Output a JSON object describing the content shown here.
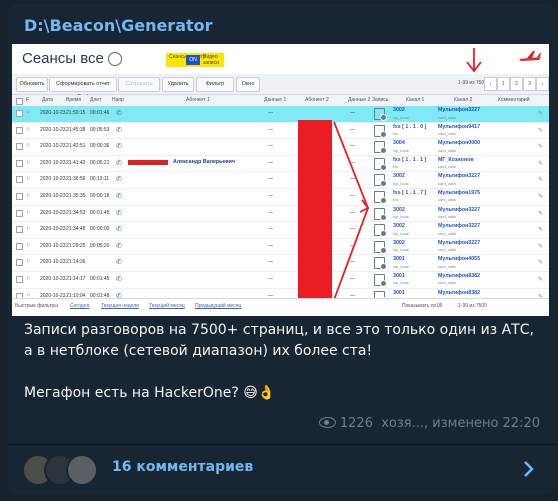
{
  "channel": {
    "title": "D:\\Beacon\\Generator"
  },
  "app": {
    "title": "Сеансы все",
    "toggle": {
      "left": "Сеансы за дату",
      "on": "ON",
      "right": "Видео записи"
    },
    "toolbar": {
      "refresh": "Обновить",
      "excel": "Сформировать отчет Exel",
      "stop": "Сохранить",
      "delete": "Удалить",
      "filter": "Фильтр",
      "window": "Окно",
      "pager": "1-99 из 7505"
    },
    "columns": [
      "Дата",
      "Время",
      "Длит",
      "Напр",
      "Абонент 1",
      "Данные 1",
      "Абонент 2",
      "Данные 2",
      "Запись",
      "Канал 1",
      "Канал 2",
      "Комментарий"
    ],
    "rows": [
      {
        "date": "2020-10-23",
        "time": "21:50:15",
        "dur": "00:01:46",
        "d1": "—",
        "ab2": "",
        "d2": "—",
        "k1": "3002",
        "k1s": "sip_local",
        "k2": "Мультифон3227",
        "k2s": "card_calls"
      },
      {
        "date": "2020-10-23",
        "time": "21:45:38",
        "dur": "00:05:53",
        "d1": "—",
        "ab2": "890",
        "d2": "—",
        "k1": "fxs [ 1 . 1 . 0 ]",
        "k1s": "fxs",
        "k2": "Мультифон9417",
        "k2s": "card_calls"
      },
      {
        "date": "2020-10-23",
        "time": "21:42:51",
        "dur": "00:00:36",
        "d1": "—",
        "ab2": "892",
        "d2": "—",
        "k1": "3004",
        "k1s": "sip_local",
        "k2": "Мультифон0000",
        "k2s": "card_calls"
      },
      {
        "date": "2020-10-23",
        "time": "21:41:43",
        "dur": "00:05:21",
        "abon": "Александр Валерьевич",
        "d1": "—",
        "ab2": "790",
        "d2": "—",
        "k1": "fxs [ 1 . 1 . 1 ]",
        "k1s": "fxs",
        "k2": "МГ_Козионов",
        "k2s": "card_calls"
      },
      {
        "date": "2020-10-23",
        "time": "21:36:56",
        "dur": "00:13:11",
        "d1": "—",
        "ab2": "890",
        "d2": "—",
        "k1": "3002",
        "k1s": "sip_local",
        "k2": "Мультифон3227",
        "k2s": "card_calls"
      },
      {
        "date": "2020-10-23",
        "time": "21:35:35",
        "dur": "00:00:18",
        "d1": "—",
        "ab2": "",
        "d2": "—",
        "k1": "fxs [ 1 . 1 . 7 ]",
        "k1s": "fxs",
        "k2": "Мультифон1975",
        "k2s": "card_calls"
      },
      {
        "date": "2020-10-23",
        "time": "21:34:53",
        "dur": "00:01:45",
        "d1": "—",
        "ab2": "",
        "d2": "—",
        "k1": "3002",
        "k1s": "sip_local",
        "k2": "Мультифон3227",
        "k2s": "card_calls"
      },
      {
        "date": "2020-10-23",
        "time": "21:34:48",
        "dur": "00:00:00",
        "d1": "—",
        "ab2": "",
        "d2": "—",
        "k1": "3002",
        "k1s": "sip_local",
        "k2": "Мультифон3227",
        "k2s": "card_calls"
      },
      {
        "date": "2020-10-23",
        "time": "21:29:25",
        "dur": "00:05:20",
        "d1": "—",
        "ab2": "893",
        "d2": "—",
        "k1": "3002",
        "k1s": "sip_local",
        "k2": "Мультифон3227",
        "k2s": "card_calls"
      },
      {
        "date": "2020-10-23",
        "time": "21:14:36",
        "dur": "",
        "d1": "—",
        "ab2": "",
        "d2": "—",
        "k1": "3001",
        "k1s": "sip_local",
        "k2": "Мультифон4055",
        "k2s": "card_calls"
      },
      {
        "date": "2020-10-23",
        "time": "21:14:17",
        "dur": "00:01:45",
        "d1": "—",
        "ab2": "",
        "d2": "—",
        "k1": "3001",
        "k1s": "sip_local",
        "k2": "Мультифон8382",
        "k2s": "card_calls"
      },
      {
        "date": "2020-10-23",
        "time": "21:10:04",
        "dur": "00:01:48",
        "d1": "—",
        "ab2": "792",
        "d2": "—",
        "k1": "3001",
        "k1s": "sip_local",
        "k2": "Мультифон8382",
        "k2s": "card_calls"
      }
    ],
    "footer": {
      "quick": "Быстрые фильтры",
      "links": [
        "Сегодня",
        "Текущая неделя",
        "Текущий месяц",
        "Предыдущий месяц"
      ],
      "show": "Показывать по:",
      "show_val": "99",
      "pager": "1-99 из 7505"
    }
  },
  "post": {
    "line1": "Записи разговоров на 7500+ страниц, и все это только один из АТС, а в нетблоке (сетевой диапазон) их более ста!",
    "line2": "Мегафон есть на HackerOne? 😅👌",
    "views": "1226",
    "author": "хозя..., изменено 22:20"
  },
  "comments": {
    "label": "16 комментариев"
  },
  "colors": {
    "accent": "#71b9f2",
    "highlight_row": "#7fe9f5",
    "redact": "#ec1c24",
    "link": "#1d54c7"
  }
}
